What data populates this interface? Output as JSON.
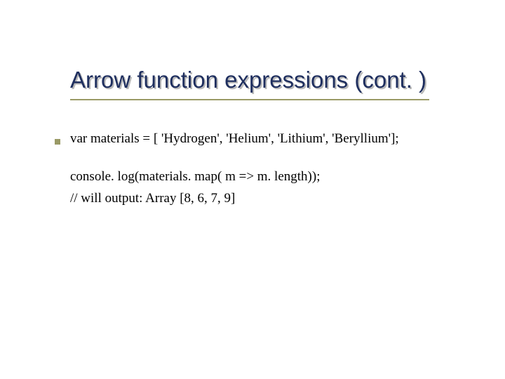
{
  "title": "Arrow function expressions (cont. )",
  "code": {
    "line1": "var materials = [  'Hydrogen',  'Helium',  'Lithium', 'Beryllium'];",
    "line2": "console. log(materials. map( m => m. length));",
    "line3": "// will output: Array [8, 6, 7, 9]"
  }
}
